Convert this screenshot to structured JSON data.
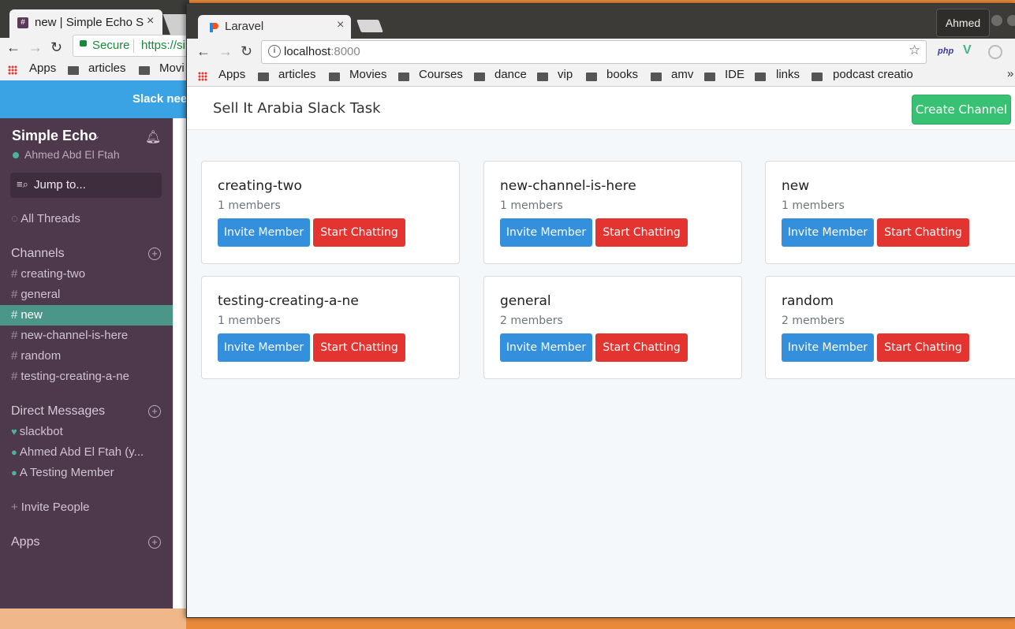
{
  "back_browser": {
    "tab_title": "new | Simple Echo S",
    "address": {
      "secure_label": "Secure",
      "url": "https://si"
    },
    "bookmarks": [
      "Apps",
      "articles",
      "Movi"
    ],
    "banner_text": "Slack nee"
  },
  "slack": {
    "workspace": "Simple Echo",
    "user": "Ahmed Abd El Ftah",
    "jump_placeholder": "Jump to...",
    "all_threads": "All Threads",
    "channels_header": "Channels",
    "channels": [
      "creating-two",
      "general",
      "new",
      "new-channel-is-here",
      "random",
      "testing-creating-a-ne"
    ],
    "active_channel": "new",
    "dm_header": "Direct Messages",
    "direct_messages": [
      "slackbot",
      "Ahmed Abd El Ftah  (y...",
      "A Testing Member"
    ],
    "invite_people": "Invite People",
    "apps": "Apps"
  },
  "front_browser": {
    "tab_title": "Laravel",
    "user_name": "Ahmed",
    "address": {
      "host": "localhost",
      "port": ":8000"
    },
    "extensions": [
      "php",
      "V"
    ],
    "bookmarks": [
      "Apps",
      "articles",
      "Movies",
      "Courses",
      "dance",
      "vip",
      "books",
      "amv",
      "IDE",
      "links",
      "podcast creatio"
    ],
    "more": "»"
  },
  "app": {
    "brand": "Sell It Arabia Slack Task",
    "create_channel_label": "Create Channel",
    "invite_label": "Invite Member",
    "chat_label": "Start Chatting",
    "channels": [
      {
        "name": "creating-two",
        "members": "1 members"
      },
      {
        "name": "new-channel-is-here",
        "members": "1 members"
      },
      {
        "name": "new",
        "members": "1 members"
      },
      {
        "name": "testing-creating-a-ne",
        "members": "1 members"
      },
      {
        "name": "general",
        "members": "2 members"
      },
      {
        "name": "random",
        "members": "2 members"
      }
    ]
  },
  "colors": {
    "slack_sidebar": "#4d394b",
    "slack_active": "#4c9689",
    "invite_blue": "#3490dc",
    "chat_red": "#e3342f",
    "create_green": "#38c172"
  }
}
